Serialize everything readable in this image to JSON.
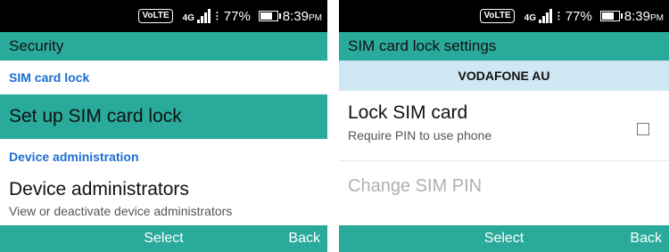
{
  "status": {
    "volte": "VoLTE",
    "network": "4G",
    "battery": "77%",
    "battery_level": 0.77,
    "time": "8:39",
    "ampm": "PM"
  },
  "left": {
    "title": "Security",
    "section1": "SIM card lock",
    "item1": "Set up SIM card lock",
    "section2": "Device administration",
    "item2_title": "Device administrators",
    "item2_sub": "View or deactivate device administrators",
    "softkeys": {
      "center": "Select",
      "right": "Back"
    }
  },
  "right": {
    "title": "SIM card lock settings",
    "carrier": "VODAFONE AU",
    "lock_title": "Lock SIM card",
    "lock_sub": "Require PIN to use phone",
    "lock_checked": false,
    "change_pin": "Change SIM PIN",
    "softkeys": {
      "center": "Select",
      "right": "Back"
    }
  },
  "colors": {
    "accent": "#2aaa9b",
    "section": "#1b6fd0",
    "carrier_bg": "#cfe8f4"
  }
}
